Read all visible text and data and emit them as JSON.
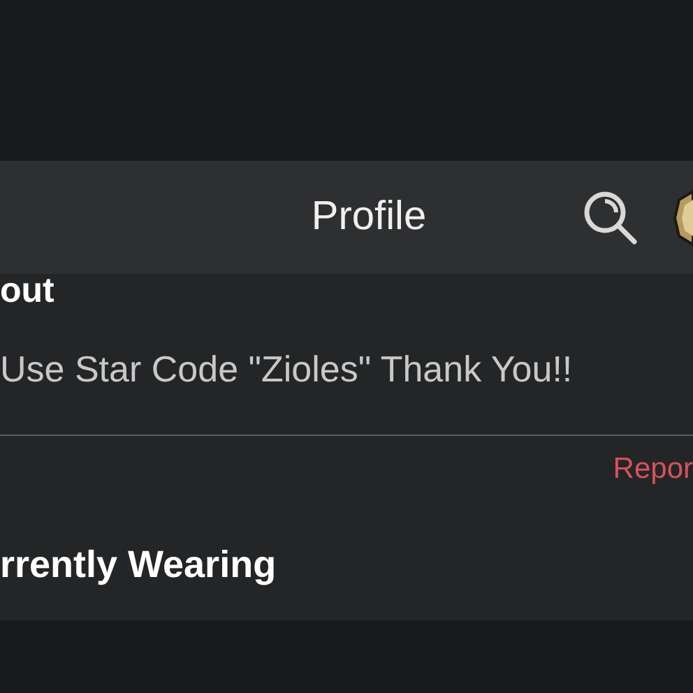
{
  "header": {
    "title": "Profile"
  },
  "about": {
    "heading": "out",
    "bio": "Use Star Code \"Zioles\" Thank You!!",
    "report_link": "Repor"
  },
  "wearing": {
    "heading": "rrently Wearing"
  }
}
